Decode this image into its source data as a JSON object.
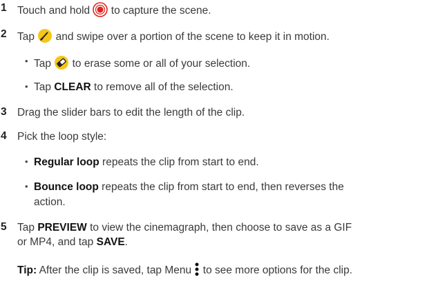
{
  "steps": {
    "s1": {
      "number": "1",
      "before": "Touch and hold",
      "after": "to capture the scene."
    },
    "s2": {
      "number": "2",
      "before": "Tap",
      "after": "and swipe over a portion of the scene to keep it in motion.",
      "sub1_before": "Tap",
      "sub1_after": "to erase some or all of your selection.",
      "sub2_before": "Tap",
      "sub2_bold": "CLEAR",
      "sub2_after": "to remove all of the selection."
    },
    "s3": {
      "number": "3",
      "text": "Drag the slider bars to edit the length of the clip."
    },
    "s4": {
      "number": "4",
      "text": "Pick the loop style:",
      "sub1_bold": "Regular loop",
      "sub1_after": "repeats the clip from start to end.",
      "sub2_bold": "Bounce loop",
      "sub2_after": "repeats the clip from start to end, then reverses the",
      "sub2_cont": "action."
    },
    "s5": {
      "number": "5",
      "before": "Tap",
      "bold1": "PREVIEW",
      "after": "to view the cinemagraph, then choose to save as a GIF",
      "cont_before": "or MP4, and tap",
      "bold2": "SAVE",
      "cont_after": "."
    }
  },
  "tip": {
    "label": "Tip:",
    "before": "After the clip is saved, tap Menu",
    "after": "to see more options for the clip."
  },
  "icons": {
    "record": "record-button-icon",
    "brush": "brush-icon",
    "eraser": "eraser-icon",
    "menu": "menu-dots-icon"
  },
  "colors": {
    "record_red": "#e2231a",
    "brush_yellow": "#f5c518"
  }
}
